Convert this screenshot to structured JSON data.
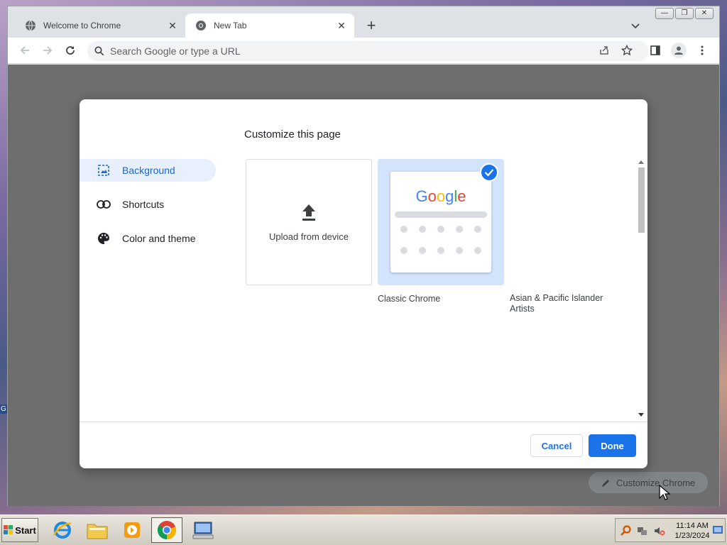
{
  "window_controls": {
    "minimize": "—",
    "restore": "❐",
    "close": "✕"
  },
  "tabs": [
    {
      "title": "Welcome to Chrome",
      "active": false
    },
    {
      "title": "New Tab",
      "active": true
    }
  ],
  "toolbar": {
    "omnibox_placeholder": "Search Google or type a URL"
  },
  "dialog": {
    "title": "Customize this page",
    "menu": [
      {
        "label": "Background",
        "selected": true,
        "icon": "image-icon"
      },
      {
        "label": "Shortcuts",
        "selected": false,
        "icon": "link-icon"
      },
      {
        "label": "Color and theme",
        "selected": false,
        "icon": "palette-icon"
      }
    ],
    "tiles": {
      "upload_label": "Upload from device",
      "classic_label": "Classic Chrome",
      "classic_logo": "Google",
      "classic_selected": true,
      "api_label_line1": "Asian & Pacific Islander",
      "api_label_line2": "Artists"
    },
    "buttons": {
      "cancel": "Cancel",
      "done": "Done"
    }
  },
  "page": {
    "customize_chrome": "Customize Chrome"
  },
  "taskbar": {
    "start": "Start",
    "apps": [
      "internet-explorer",
      "file-explorer",
      "media-player",
      "chrome",
      "remote-desktop"
    ],
    "clock_time": "11:14 AM",
    "clock_date": "1/23/2024"
  },
  "desktop": {
    "edge_label": "G"
  },
  "colors": {
    "accent": "#1a73e8",
    "selected_bg": "#e8f0fe",
    "tile_selected_bg": "#d2e3fc",
    "backdrop": "#6e6e6e"
  }
}
